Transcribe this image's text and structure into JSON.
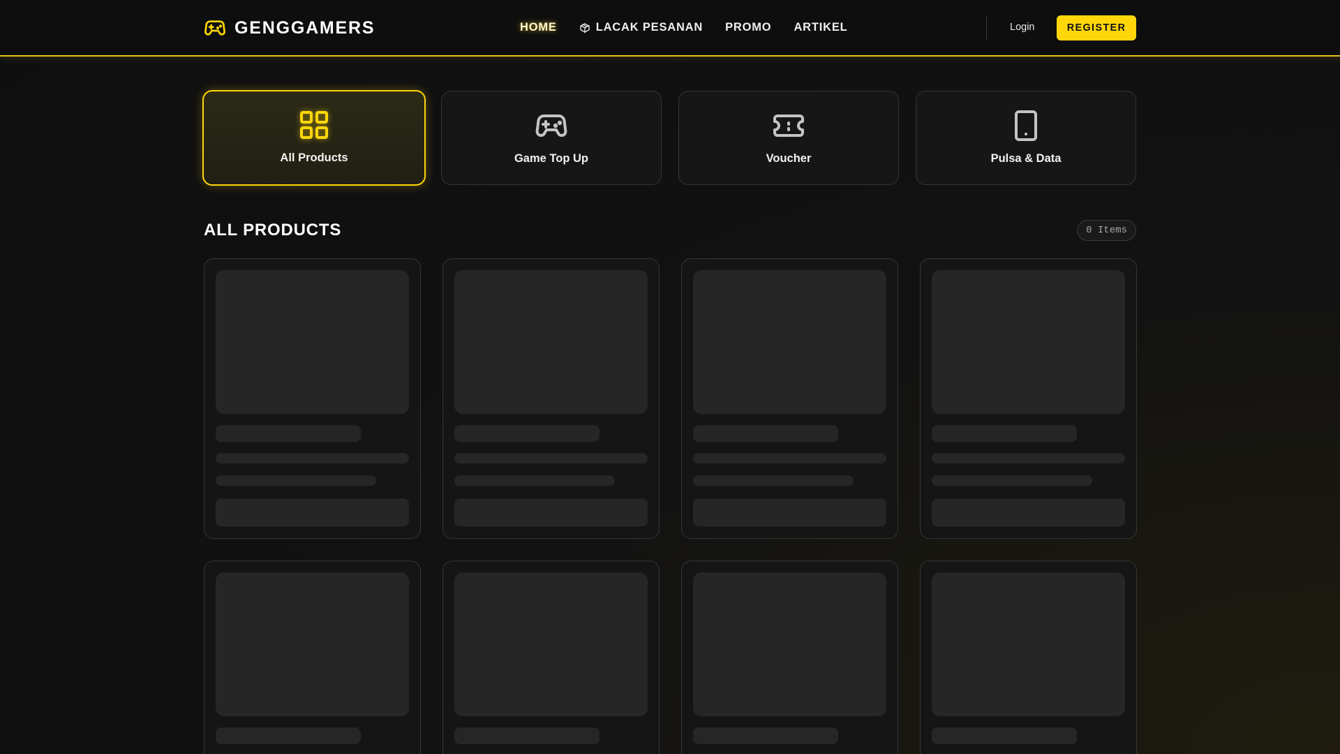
{
  "brand": {
    "name": "GENGGAMERS",
    "accent_color": "#ffd60a",
    "icon": "gamepad-icon"
  },
  "nav": {
    "links": [
      {
        "label": "HOME",
        "active": true
      },
      {
        "label": "LACAK PESANAN",
        "icon": "package-icon"
      },
      {
        "label": "PROMO"
      },
      {
        "label": "ARTIKEL"
      }
    ],
    "login_label": "Login",
    "register_label": "REGISTER"
  },
  "categories": [
    {
      "label": "All Products",
      "icon": "grid-icon",
      "active": true
    },
    {
      "label": "Game Top Up",
      "icon": "gamepad-icon"
    },
    {
      "label": "Voucher",
      "icon": "ticket-icon"
    },
    {
      "label": "Pulsa & Data",
      "icon": "smartphone-icon"
    }
  ],
  "section": {
    "title": "ALL PRODUCTS",
    "count_label": "0 Items"
  },
  "products": {
    "state": "loading",
    "skeleton_cards_visible": 8
  },
  "colors": {
    "accent": "#ffd60a",
    "background": "#121212",
    "card": "#151515",
    "skeleton": "#262626"
  }
}
